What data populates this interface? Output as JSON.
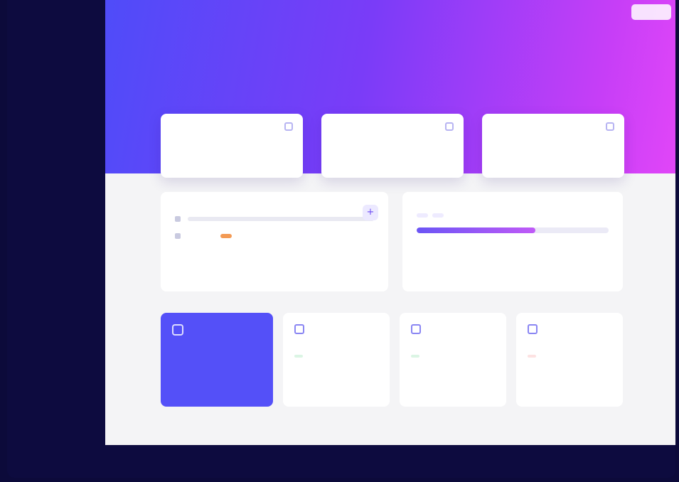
{
  "app": {
    "logo": ""
  },
  "sidebar": {
    "items": [
      "",
      "",
      "",
      "",
      "",
      "",
      ""
    ]
  },
  "header": {
    "user": "",
    "title": "",
    "subtitle": ""
  },
  "stats": [
    {
      "label": "",
      "value": ""
    },
    {
      "label": "",
      "value": ""
    },
    {
      "label": "",
      "value": ""
    }
  ],
  "tasks": {
    "title": "",
    "action": "+",
    "tag": ""
  },
  "goals": {
    "title": "",
    "pills": [
      "",
      ""
    ],
    "progress": 0.62
  },
  "feature": {
    "title": "",
    "value": ""
  },
  "metrics": [
    {
      "label": "",
      "value": "",
      "change": ""
    },
    {
      "label": "",
      "value": "",
      "change": ""
    },
    {
      "label": "",
      "value": "",
      "change": ""
    }
  ],
  "footer": {
    "text": ""
  },
  "colors": {
    "accent": "#5450f8",
    "gradient_start": "#4f4cf9",
    "gradient_end": "#e146f8",
    "sidebar": "#0d0b3f"
  }
}
